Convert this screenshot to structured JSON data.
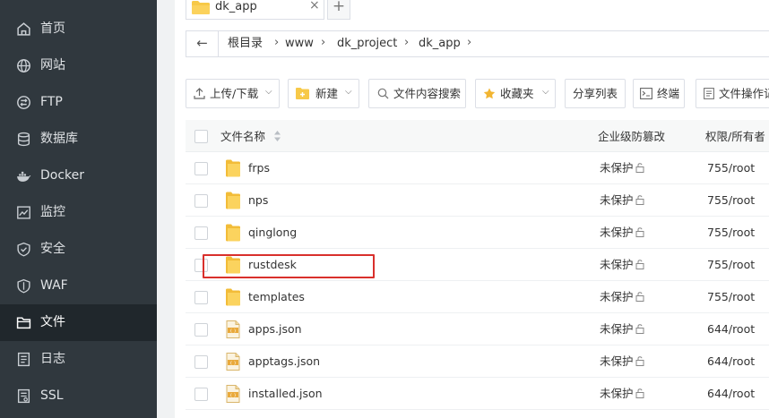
{
  "sidebar": {
    "items": [
      {
        "label": "首页",
        "icon": "home-icon",
        "active": false
      },
      {
        "label": "网站",
        "icon": "globe-icon",
        "active": false
      },
      {
        "label": "FTP",
        "icon": "ftp-icon",
        "active": false
      },
      {
        "label": "数据库",
        "icon": "database-icon",
        "active": false
      },
      {
        "label": "Docker",
        "icon": "docker-icon",
        "active": false
      },
      {
        "label": "监控",
        "icon": "monitor-icon",
        "active": false
      },
      {
        "label": "安全",
        "icon": "shield-icon",
        "active": false
      },
      {
        "label": "WAF",
        "icon": "waf-shield-icon",
        "active": false
      },
      {
        "label": "文件",
        "icon": "folder-icon",
        "active": true
      },
      {
        "label": "日志",
        "icon": "log-icon",
        "active": false
      },
      {
        "label": "SSL",
        "icon": "ssl-icon",
        "active": false
      }
    ]
  },
  "tab": {
    "label": "dk_app",
    "close": "×",
    "add": "+"
  },
  "breadcrumb": {
    "back": "←",
    "items": [
      "根目录",
      "www",
      "dk_project",
      "dk_app"
    ],
    "separator": "›"
  },
  "toolbar": {
    "upload": "上传/下载",
    "new": "新建",
    "search_content": "文件内容搜索",
    "favorites": "收藏夹",
    "share_list": "分享列表",
    "terminal": "终端",
    "file_ops": "文件操作记"
  },
  "table": {
    "headers": {
      "name": "文件名称",
      "protect": "企业级防篡改",
      "perm": "权限/所有者"
    },
    "rows": [
      {
        "name": "frps",
        "type": "folder",
        "protect": "未保护",
        "perm": "755/root"
      },
      {
        "name": "nps",
        "type": "folder",
        "protect": "未保护",
        "perm": "755/root"
      },
      {
        "name": "qinglong",
        "type": "folder",
        "protect": "未保护",
        "perm": "755/root"
      },
      {
        "name": "rustdesk",
        "type": "folder",
        "protect": "未保护",
        "perm": "755/root",
        "highlighted": true
      },
      {
        "name": "templates",
        "type": "folder",
        "protect": "未保护",
        "perm": "755/root"
      },
      {
        "name": "apps.json",
        "type": "json",
        "protect": "未保护",
        "perm": "644/root"
      },
      {
        "name": "apptags.json",
        "type": "json",
        "protect": "未保护",
        "perm": "644/root"
      },
      {
        "name": "installed.json",
        "type": "json",
        "protect": "未保护",
        "perm": "644/root"
      }
    ]
  },
  "colors": {
    "sidebar_bg": "#30383e",
    "sidebar_active": "#20272c",
    "folder": "#f7c948",
    "accent_green": "#20a53a",
    "highlight": "#d9302c"
  }
}
